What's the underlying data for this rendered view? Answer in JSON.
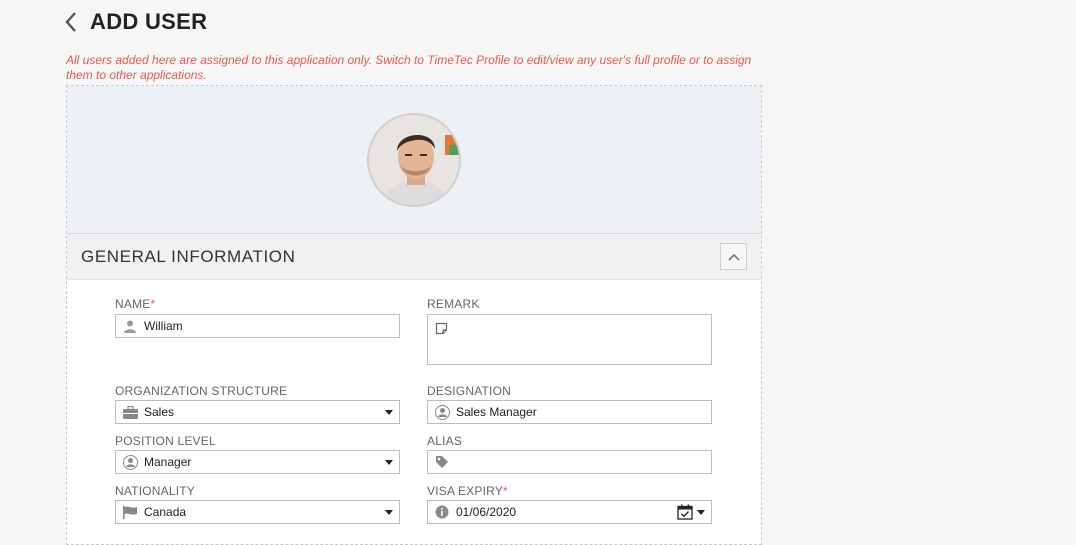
{
  "header": {
    "title": "ADD USER"
  },
  "notice": "All users added here are assigned to this application only. Switch to TimeTec Profile to edit/view any user's full profile or to assign them to other applications.",
  "section": {
    "title": "GENERAL INFORMATION"
  },
  "colors": {
    "accent_red": "#e55a4f",
    "panel_bg": "#edf0f4"
  },
  "form": {
    "name": {
      "label": "NAME",
      "required": "*",
      "value": "William",
      "icon": "person-icon"
    },
    "remark": {
      "label": "REMARK",
      "icon": "note-icon"
    },
    "org_structure": {
      "label": "ORGANIZATION STRUCTURE",
      "value": "Sales",
      "icon": "briefcase-icon"
    },
    "designation": {
      "label": "DESIGNATION",
      "value": "Sales Manager",
      "icon": "user-circle-icon"
    },
    "position_level": {
      "label": "POSITION LEVEL",
      "value": "Manager",
      "icon": "user-circle-icon"
    },
    "alias": {
      "label": "ALIAS",
      "icon": "tag-icon"
    },
    "nationality": {
      "label": "NATIONALITY",
      "value": "Canada",
      "icon": "flag-icon"
    },
    "visa_expiry": {
      "label": "VISA EXPIRY",
      "required": "*",
      "value": "01/06/2020",
      "icon": "info-icon"
    }
  }
}
